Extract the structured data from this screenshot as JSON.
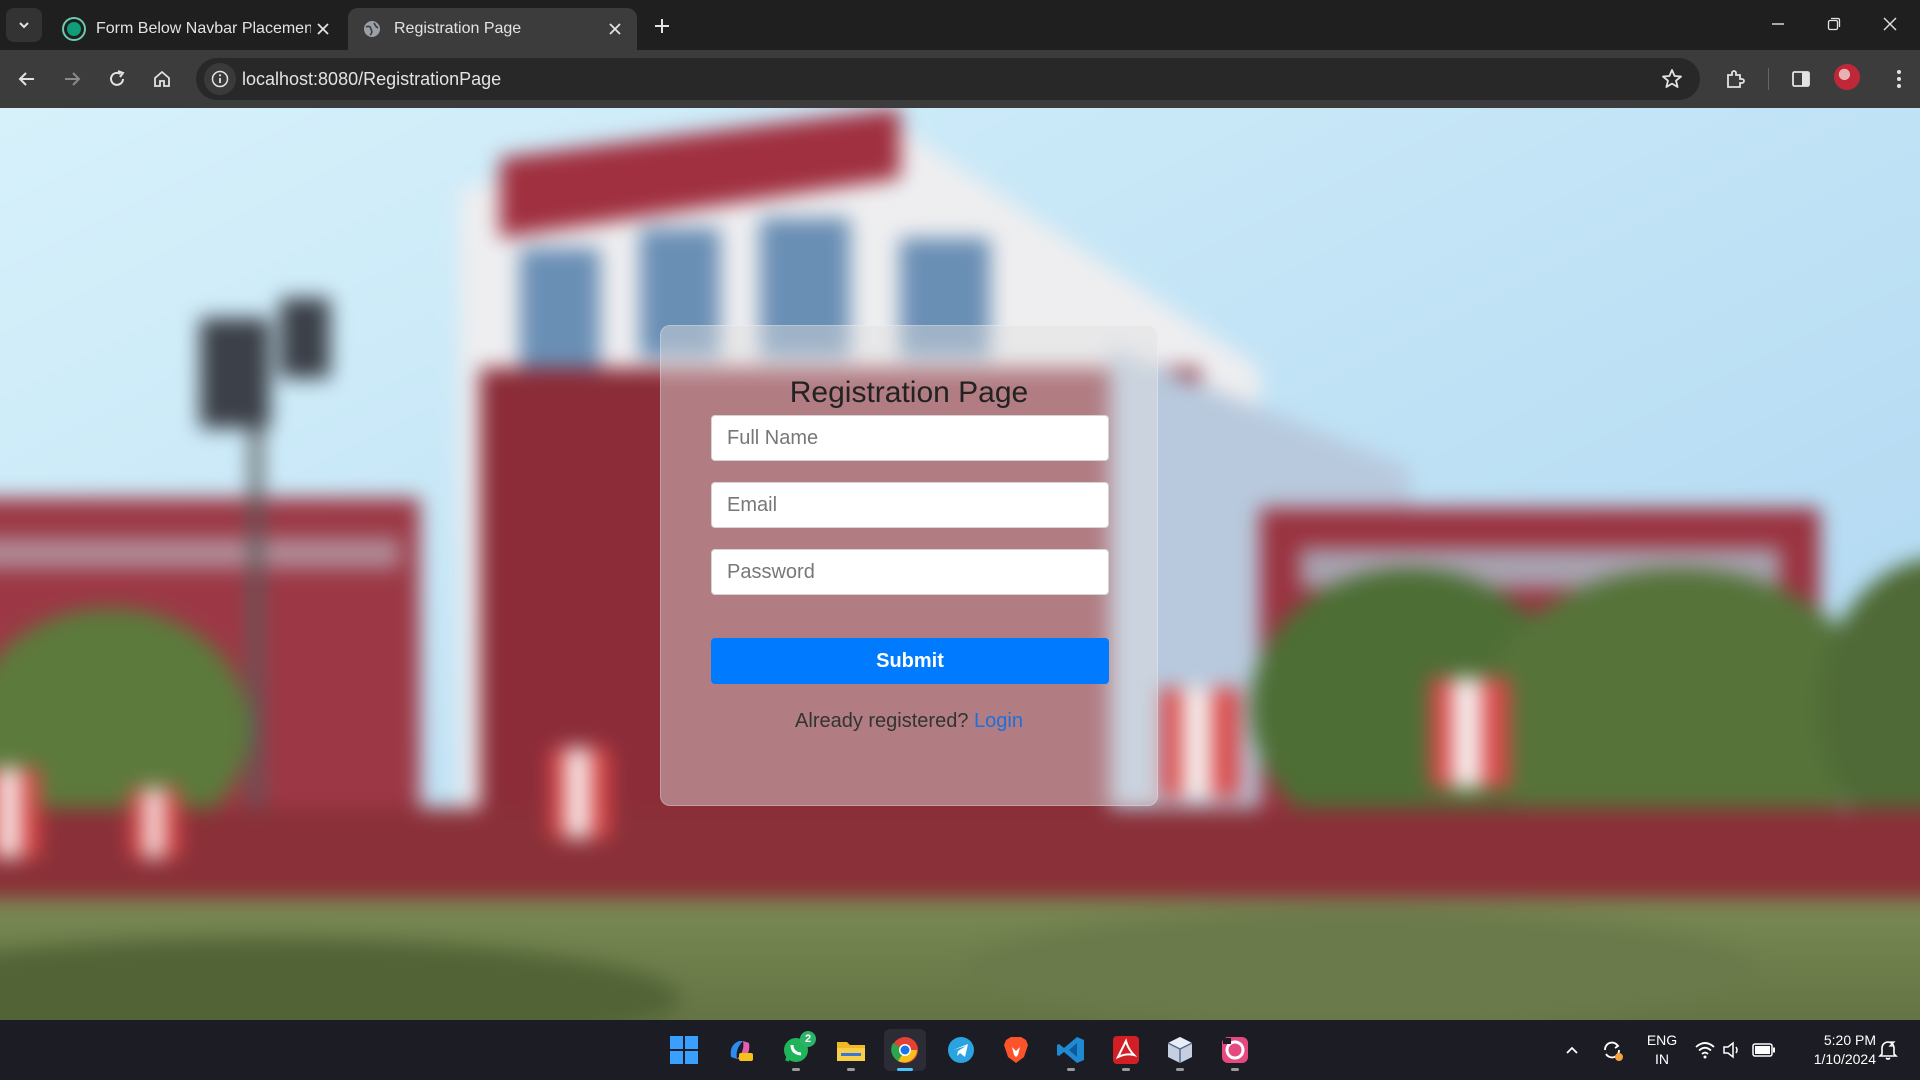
{
  "browser": {
    "tabs": [
      {
        "title": "Form Below Navbar Placement",
        "active": false,
        "favicon": "chatgpt-icon"
      },
      {
        "title": "Registration Page",
        "active": true,
        "favicon": "globe-icon"
      }
    ],
    "url": "localhost:8080/RegistrationPage"
  },
  "form": {
    "title": "Registration Page",
    "fields": {
      "full_name_placeholder": "Full Name",
      "email_placeholder": "Email",
      "password_placeholder": "Password"
    },
    "submit_label": "Submit",
    "already_text": "Already registered?",
    "login_link": "Login"
  },
  "taskbar": {
    "whatsapp_badge": "2",
    "language": {
      "line1": "ENG",
      "line2": "IN"
    },
    "time": "5:20 PM",
    "date": "1/10/2024"
  },
  "colors": {
    "accent": "#007bff",
    "link": "#1e6fd9",
    "chrome_dark": "#1f1f1f",
    "toolbar": "#3c3c3c"
  }
}
